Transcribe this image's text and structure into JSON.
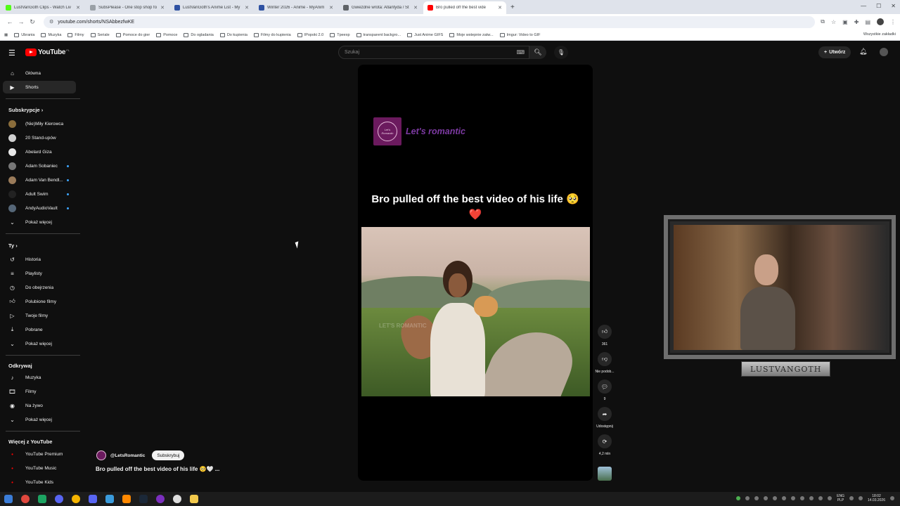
{
  "browser": {
    "tabs": [
      {
        "label": "LustVanGoth Clips - Watch Liv",
        "color": "#53fc18",
        "active": false
      },
      {
        "label": "SubsPlease - One stop shop fo",
        "color": "#9aa0a6",
        "active": false
      },
      {
        "label": "LustVanGoth's Anime List - My",
        "color": "#2e51a2",
        "active": false
      },
      {
        "label": "Winter 2026 - Anime - MyAnim",
        "color": "#2e51a2",
        "active": false
      },
      {
        "label": "Gwiezdne wrota: Atlantyda / St",
        "color": "#5f6368",
        "active": false
      },
      {
        "label": "Bro pulled off the best vide",
        "color": "#ff0000",
        "active": true
      }
    ],
    "url": "youtube.com/shorts/NSAbbezfwKE",
    "bookmarks": [
      {
        "label": "Ubrania"
      },
      {
        "label": "Muzyka"
      },
      {
        "label": "Filmy"
      },
      {
        "label": "Seriale"
      },
      {
        "label": "Pomoce do gier"
      },
      {
        "label": "Pomoce"
      },
      {
        "label": "Do ogladania"
      },
      {
        "label": "Do kupienia"
      },
      {
        "label": "Filmy do kupienia"
      },
      {
        "label": "IPopoki 2.0"
      },
      {
        "label": "Tpeexp"
      },
      {
        "label": "transparent backgro..."
      },
      {
        "label": "Just Anime GIFS"
      },
      {
        "label": "Moje wstepnie zatw..."
      },
      {
        "label": "Imgur: Video to GIF"
      }
    ],
    "bookmarks_all": "Wszystkie zakładki"
  },
  "header": {
    "logo": "YouTube",
    "logo_country": "PL",
    "search_placeholder": "Szukaj",
    "create_label": "Utwórz"
  },
  "sidebar": {
    "main": [
      {
        "label": "Główna",
        "icon": "home-icon"
      },
      {
        "label": "Shorts",
        "icon": "shorts-icon"
      }
    ],
    "subs_title": "Subskrypcje",
    "subscriptions": [
      {
        "label": "(Nie)Miły Kierowca",
        "color": "#8a6d3b",
        "dot": false
      },
      {
        "label": "20 Stand-upów",
        "color": "#d0d0d0",
        "dot": false
      },
      {
        "label": "Abelard Giza",
        "color": "#e8e8e8",
        "dot": false
      },
      {
        "label": "Adam Sobaniec",
        "color": "#777777",
        "dot": true
      },
      {
        "label": "Adam Van Bendl...",
        "color": "#9a7b5a",
        "dot": true
      },
      {
        "label": "Adult Swim",
        "color": "#222222",
        "dot": true
      },
      {
        "label": "AndyAudioVault",
        "color": "#556677",
        "dot": true
      }
    ],
    "show_more": "Pokaż więcej",
    "you_title": "Ty",
    "you": [
      {
        "label": "Historia",
        "icon": "history-icon"
      },
      {
        "label": "Playlisty",
        "icon": "playlist-icon"
      },
      {
        "label": "Do obejrzenia",
        "icon": "watch-later-icon"
      },
      {
        "label": "Polubione filmy",
        "icon": "like-icon"
      },
      {
        "label": "Twoje filmy",
        "icon": "video-icon"
      },
      {
        "label": "Pobrane",
        "icon": "download-icon"
      }
    ],
    "explore_title": "Odkrywaj",
    "explore": [
      {
        "label": "Muzyka",
        "icon": "music-icon"
      },
      {
        "label": "Filmy",
        "icon": "film-icon"
      },
      {
        "label": "Na żywo",
        "icon": "live-icon"
      }
    ],
    "more_title": "Więcej z YouTube",
    "more": [
      {
        "label": "YouTube Premium"
      },
      {
        "label": "YouTube Music"
      },
      {
        "label": "YouTube Kids"
      }
    ]
  },
  "short": {
    "brand_text": "Let's romantic",
    "brand_logo_text": "Let's Romantic",
    "caption": "Bro pulled off the best video of his life 🥺❤️",
    "watermark": "LET'S ROMANTIC",
    "likes": "361",
    "dislike_label": "Nie podob...",
    "comments": "9",
    "share_label": "Udostępnij",
    "remix_label": "4,2 mln",
    "channel": "@LetsRomantic",
    "subscribe": "Subskrybuj",
    "title": "Bro pulled off the best video of his life 🥺🤍 ..."
  },
  "webcam": {
    "name_tag": "LUSTVANGOTH"
  },
  "taskbar": {
    "lang_top": "ENG",
    "lang_bottom": "PLP",
    "time": "18:02",
    "date": "14.03.2026"
  }
}
